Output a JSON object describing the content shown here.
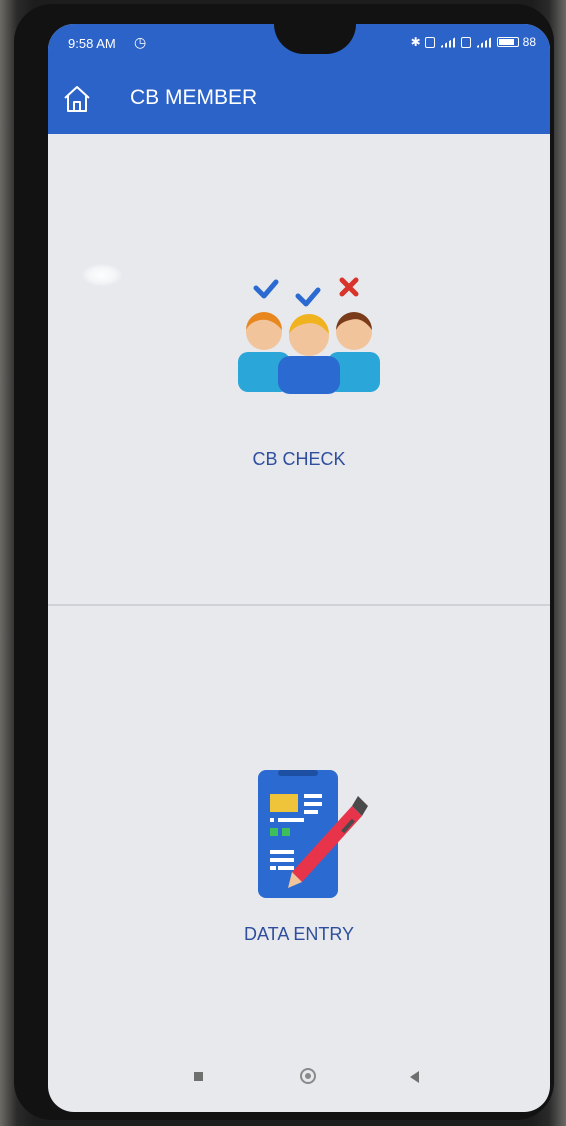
{
  "status_bar": {
    "time": "9:58 AM",
    "alarm_icon": "alarm-clock-icon",
    "bluetooth_icon": "bluetooth-icon",
    "battery_level": "88"
  },
  "app_bar": {
    "title": "CB MEMBER",
    "home_icon": "home-icon",
    "background_color": "#2b63c9"
  },
  "tiles": [
    {
      "label": "CB CHECK",
      "icon": "people-check-icon"
    },
    {
      "label": "DATA ENTRY",
      "icon": "phone-form-pen-icon"
    }
  ],
  "nav_bar": {
    "recent_icon": "square-recent-icon",
    "home_icon": "circle-home-icon",
    "back_icon": "triangle-back-icon"
  },
  "colors": {
    "label_color": "#2f4f9e",
    "screen_background": "#e7e9ed"
  }
}
